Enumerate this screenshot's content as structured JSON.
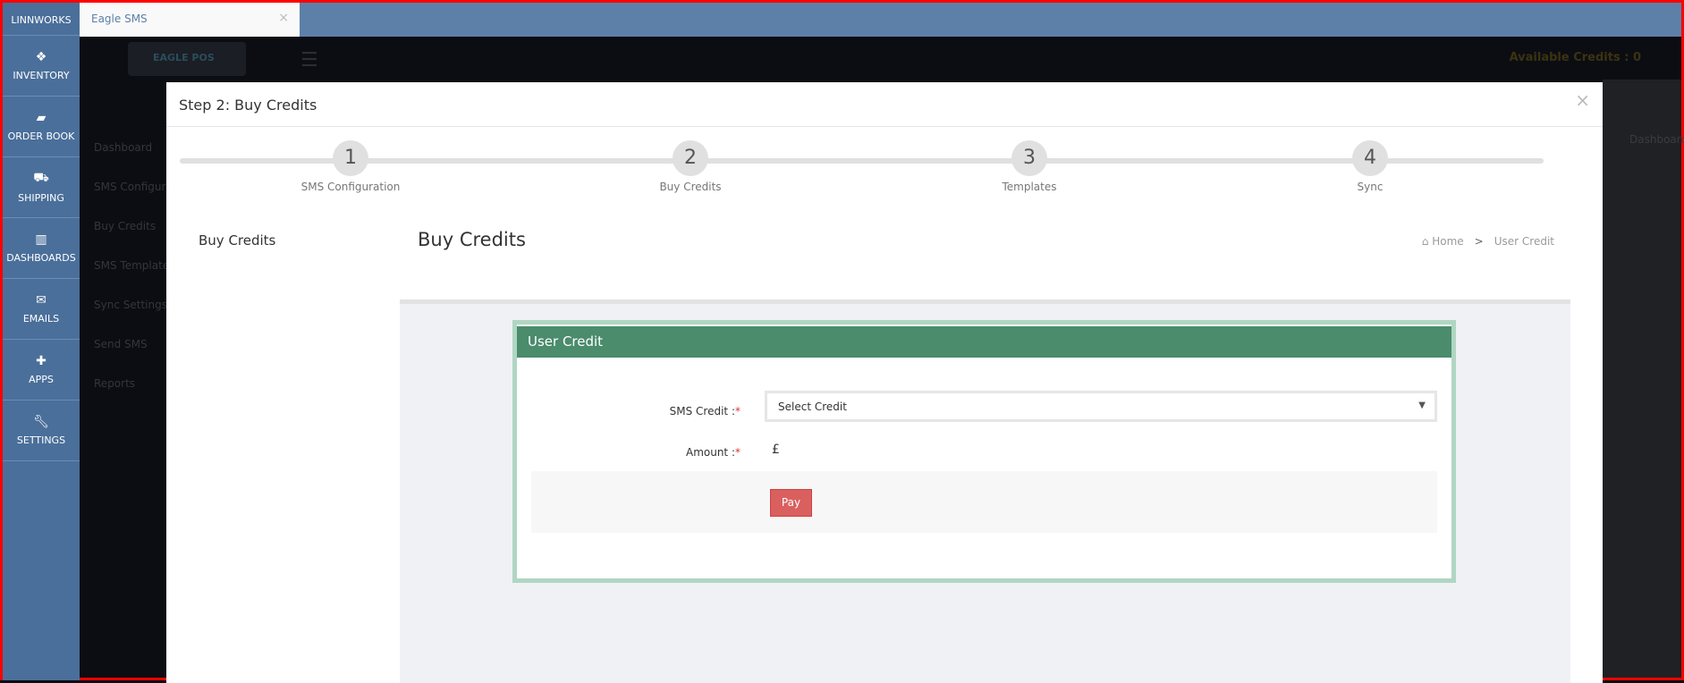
{
  "sidebar": {
    "items": [
      {
        "label": "LINNWORKS",
        "icon": "linnworks-icon"
      },
      {
        "label": "INVENTORY",
        "icon": "cubes-icon"
      },
      {
        "label": "ORDER BOOK",
        "icon": "book-icon"
      },
      {
        "label": "SHIPPING",
        "icon": "truck-icon"
      },
      {
        "label": "DASHBOARDS",
        "icon": "bar-chart-icon"
      },
      {
        "label": "EMAILS",
        "icon": "envelope-icon"
      },
      {
        "label": "APPS",
        "icon": "puzzle-icon"
      },
      {
        "label": "SETTINGS",
        "icon": "wrench-icon"
      }
    ]
  },
  "tab": {
    "label": "Eagle SMS",
    "close": "×"
  },
  "app": {
    "logo": "EAGLE POS",
    "credits": "Available Credits : 0",
    "nav": [
      "Dashboard",
      "SMS Configuration",
      "Buy Credits",
      "SMS Templates",
      "Sync Settings",
      "Send SMS",
      "Reports"
    ],
    "right_crumb": "Dashboard"
  },
  "modal": {
    "title": "Step 2: Buy Credits",
    "close": "×",
    "steps": [
      {
        "num": "1",
        "label": "SMS Configuration"
      },
      {
        "num": "2",
        "label": "Buy Credits"
      },
      {
        "num": "3",
        "label": "Templates"
      },
      {
        "num": "4",
        "label": "Sync"
      }
    ],
    "left_label": "Buy Credits",
    "page_title": "Buy Credits",
    "breadcrumb": {
      "home": "Home",
      "sep": ">",
      "current": "User Credit"
    },
    "card": {
      "title": "User Credit",
      "sms_credit_label": "SMS Credit :",
      "amount_label": "Amount :",
      "required": "*",
      "select_value": "Select Credit",
      "currency": "£",
      "pay": "Pay"
    }
  },
  "colors": {
    "sidebar": "#4a6f9a",
    "card_header": "#4a8c6c",
    "card_border": "#afd6c3",
    "pay": "#d9605f"
  }
}
